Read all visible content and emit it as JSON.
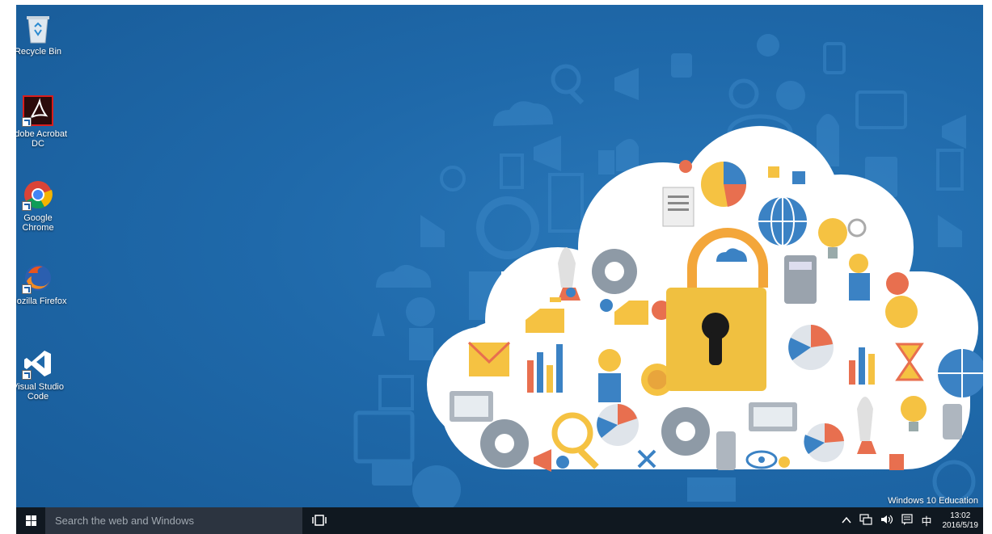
{
  "desktop": {
    "icons": [
      {
        "label": "Recycle Bin",
        "icon": "recycle-bin-icon"
      },
      {
        "label": "Adobe Acrobat DC",
        "icon": "acrobat-icon"
      },
      {
        "label": "Google Chrome",
        "icon": "chrome-icon"
      },
      {
        "label": "Mozilla Firefox",
        "icon": "firefox-icon"
      },
      {
        "label": "Visual Studio Code",
        "icon": "vscode-icon"
      }
    ],
    "edition_text": "Windows 10 Education",
    "wallpaper_accent": "#1f69aa"
  },
  "taskbar": {
    "search_placeholder": "Search the web and Windows",
    "tray_icons": [
      "chevron-up-icon",
      "network-icon",
      "volume-icon",
      "action-center-icon"
    ],
    "ime": "中",
    "time": "13:02",
    "date": "2016/5/19"
  }
}
